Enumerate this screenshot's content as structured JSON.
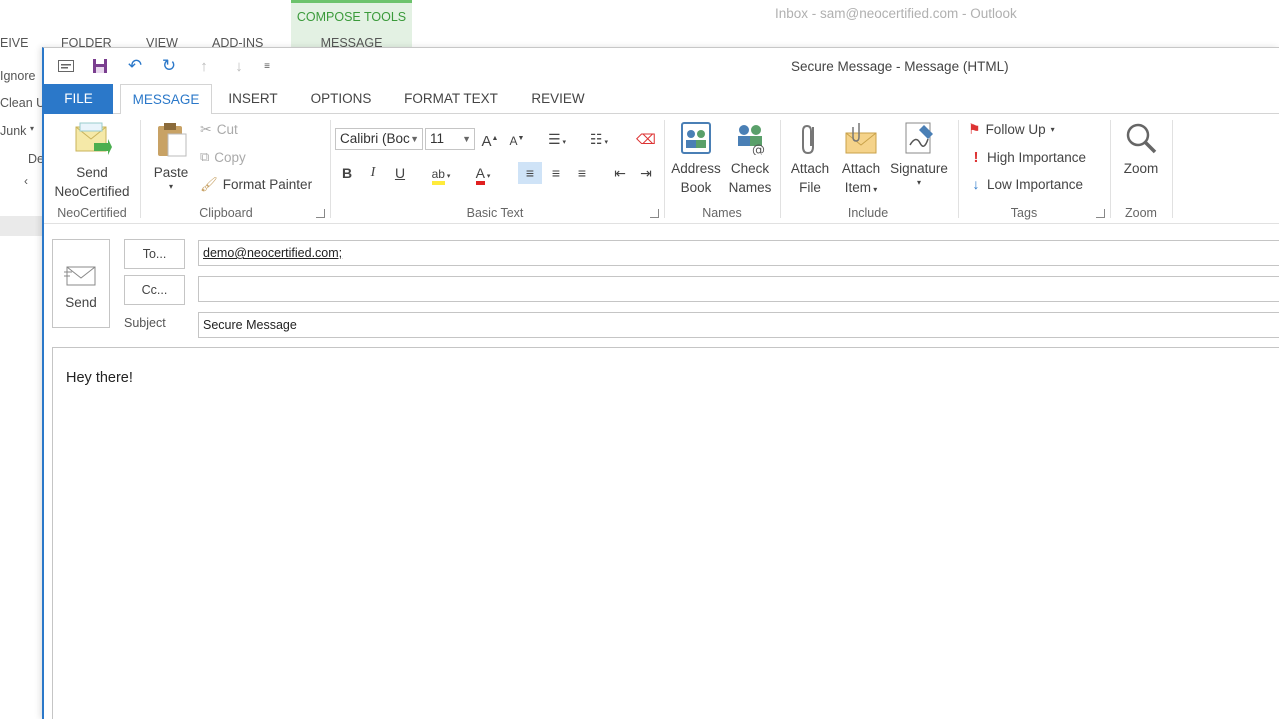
{
  "background": {
    "compose_tools": "COMPOSE TOOLS",
    "inbox_title": "Inbox - sam@neocertified.com - Outlook",
    "tabs": [
      "EIVE",
      "FOLDER",
      "VIEW",
      "ADD-INS",
      "MESSAGE"
    ],
    "left_items": [
      "Ignore",
      "Clean U",
      "Junk",
      "De"
    ]
  },
  "window": {
    "title": "Secure Message - Message (HTML)"
  },
  "tabs": {
    "file": "FILE",
    "message": "MESSAGE",
    "insert": "INSERT",
    "options": "OPTIONS",
    "format_text": "FORMAT TEXT",
    "review": "REVIEW"
  },
  "ribbon": {
    "neocertified": {
      "send_line1": "Send",
      "send_line2": "NeoCertified",
      "group": "NeoCertified"
    },
    "clipboard": {
      "paste": "Paste",
      "cut": "Cut",
      "copy": "Copy",
      "format_painter": "Format Painter",
      "group": "Clipboard"
    },
    "basic_text": {
      "font": "Calibri (Boc",
      "size": "11",
      "bold": "B",
      "italic": "I",
      "underline": "U",
      "group": "Basic Text"
    },
    "names": {
      "address_line1": "Address",
      "address_line2": "Book",
      "check_line1": "Check",
      "check_line2": "Names",
      "group": "Names"
    },
    "include": {
      "attach_file_line1": "Attach",
      "attach_file_line2": "File",
      "attach_item_line1": "Attach",
      "attach_item_line2": "Item",
      "signature": "Signature",
      "group": "Include"
    },
    "tags": {
      "follow_up": "Follow Up",
      "high": "High Importance",
      "low": "Low Importance",
      "group": "Tags"
    },
    "zoom": {
      "label": "Zoom",
      "group": "Zoom"
    }
  },
  "header": {
    "send": "Send",
    "to_btn": "To...",
    "cc_btn": "Cc...",
    "subject_label": "Subject",
    "to_value": "demo@neocertified.com;",
    "cc_value": "",
    "subject_value": "Secure Message"
  },
  "body": {
    "text": "Hey there!"
  },
  "colors": {
    "accent": "#2b78c9",
    "compose_tools": "#3a9a3a",
    "flag": "#d33",
    "importance_high": "#d33",
    "importance_low": "#2b78c9"
  }
}
